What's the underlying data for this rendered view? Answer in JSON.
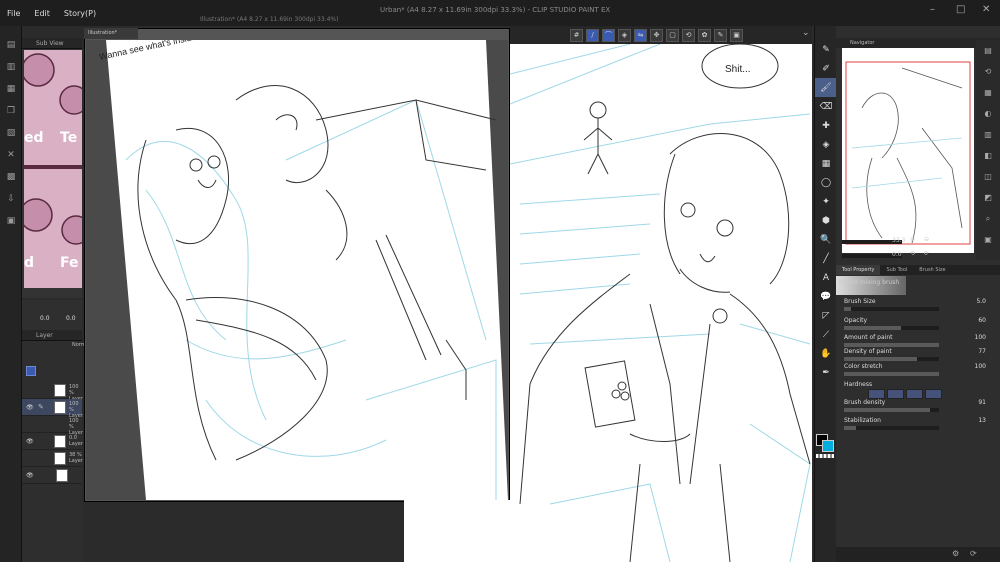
{
  "window": {
    "title": "Urban* (A4 8.27 x 11.69in 300dpi 33.3%) - CLIP STUDIO PAINT EX"
  },
  "menu": [
    {
      "label": "File"
    },
    {
      "label": "Edit"
    },
    {
      "label": "Story(P)"
    }
  ],
  "subview": {
    "title": "Sub View",
    "words": [
      "ed",
      "Te",
      "d",
      "Fe"
    ]
  },
  "left_controls": {
    "opacity": "0.0",
    "zoom": "0.0"
  },
  "layers": {
    "title": "Layer",
    "blend": "Normal",
    "rows": [
      {
        "percent": "100 %",
        "name": "Layer"
      },
      {
        "percent": "100 %",
        "name": "Layer"
      },
      {
        "percent": "100 %",
        "name": "Layer"
      },
      {
        "percent": "0.0",
        "name": "Layer"
      },
      {
        "percent": "38 %",
        "name": "Layer"
      }
    ]
  },
  "document": {
    "tab": "Illustration*",
    "title": "Illustration* (A4 8.27 x 11.69in 300dpi 33.4%)"
  },
  "canvas1": {
    "speech": "Wanna see what's inside my head?"
  },
  "maincanvas": {
    "speech": "Shit..."
  },
  "navigator": {
    "title": "Navigator",
    "zoom": "33.3",
    "rotate": "0.0"
  },
  "tool_property": {
    "tabs": [
      "Tool Property",
      "Sub Tool",
      "Brush Size"
    ],
    "brush_name": "Round mixing brush",
    "props": [
      {
        "label": "Brush Size",
        "value": "5.0",
        "fill": 0.07
      },
      {
        "label": "Opacity",
        "value": "60",
        "fill": 0.6
      },
      {
        "label": "Amount of paint",
        "value": "100",
        "fill": 1.0
      },
      {
        "label": "Density of paint",
        "value": "77",
        "fill": 0.77
      },
      {
        "label": "Color stretch",
        "value": "100",
        "fill": 1.0
      },
      {
        "label": "Hardness",
        "value": "",
        "fill": 0
      },
      {
        "label": "Brush density",
        "value": "91",
        "fill": 0.91
      },
      {
        "label": "Stabilization",
        "value": "13",
        "fill": 0.13
      }
    ]
  },
  "colors": {
    "main": "#000000",
    "sub": "#00aee0",
    "accent": "#3b5bb3"
  }
}
